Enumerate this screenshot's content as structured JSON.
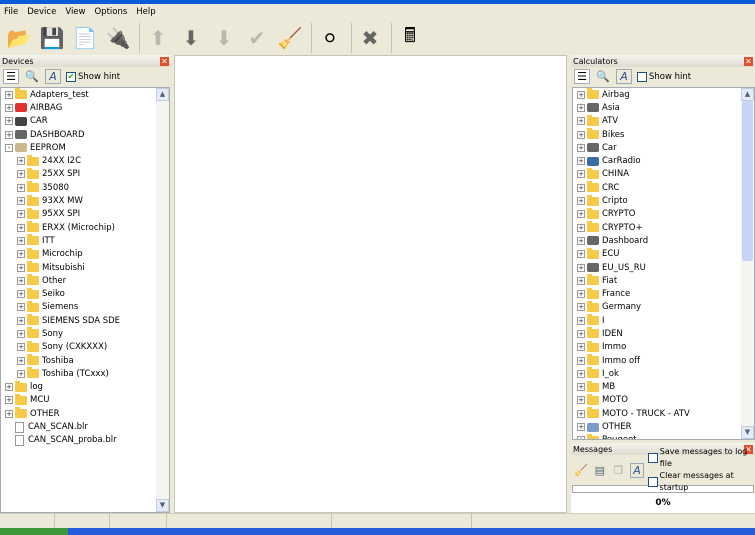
{
  "menu": [
    "File",
    "Device",
    "View",
    "Options",
    "Help"
  ],
  "toolbar": [
    {
      "icon": "open-folder-icon",
      "glyph": "📂"
    },
    {
      "icon": "save-download-icon",
      "glyph": "💾"
    },
    {
      "icon": "new-document-icon",
      "glyph": "📄"
    },
    {
      "icon": "chip-icon",
      "glyph": "🔌"
    },
    {
      "icon": "arrow-up-icon",
      "glyph": "⬆"
    },
    {
      "icon": "arrow-down-icon",
      "glyph": "⬇"
    },
    {
      "icon": "arrow-down-disabled-icon",
      "glyph": "⬇"
    },
    {
      "icon": "check-icon",
      "glyph": "✔"
    },
    {
      "icon": "broom-icon",
      "glyph": "🧹"
    },
    {
      "icon": "disc-icon",
      "glyph": "⚪"
    },
    {
      "icon": "cancel-x-icon",
      "glyph": "✖"
    },
    {
      "icon": "calculator-icon",
      "glyph": "🖩"
    }
  ],
  "devices": {
    "title": "Devices",
    "show_hint": "Show hint",
    "show_hint_checked": true,
    "items": [
      {
        "label": "Adapters_test",
        "level": 0,
        "type": "folder",
        "pm": "+"
      },
      {
        "label": "AIRBAG",
        "level": 0,
        "type": "airbag",
        "pm": "+"
      },
      {
        "label": "CAR",
        "level": 0,
        "type": "car",
        "pm": "+"
      },
      {
        "label": "DASHBOARD",
        "level": 0,
        "type": "dash",
        "pm": "+"
      },
      {
        "label": "EEPROM",
        "level": 0,
        "type": "chip",
        "pm": "-"
      },
      {
        "label": "24XX I2C",
        "level": 1,
        "type": "folder",
        "pm": "+"
      },
      {
        "label": "25XX SPI",
        "level": 1,
        "type": "folder",
        "pm": "+"
      },
      {
        "label": "35080",
        "level": 1,
        "type": "folder",
        "pm": "+"
      },
      {
        "label": "93XX MW",
        "level": 1,
        "type": "folder",
        "pm": "+"
      },
      {
        "label": "95XX SPI",
        "level": 1,
        "type": "folder",
        "pm": "+"
      },
      {
        "label": "ERXX (Microchip)",
        "level": 1,
        "type": "folder",
        "pm": "+"
      },
      {
        "label": "ITT",
        "level": 1,
        "type": "folder",
        "pm": "+"
      },
      {
        "label": "Microchip",
        "level": 1,
        "type": "folder",
        "pm": "+"
      },
      {
        "label": "Mitsubishi",
        "level": 1,
        "type": "folder",
        "pm": "+"
      },
      {
        "label": "Other",
        "level": 1,
        "type": "folder",
        "pm": "+"
      },
      {
        "label": "Seiko",
        "level": 1,
        "type": "folder",
        "pm": "+"
      },
      {
        "label": "Siemens",
        "level": 1,
        "type": "folder",
        "pm": "+"
      },
      {
        "label": "SIEMENS SDA SDE",
        "level": 1,
        "type": "folder",
        "pm": "+"
      },
      {
        "label": "Sony",
        "level": 1,
        "type": "folder",
        "pm": "+"
      },
      {
        "label": "Sony (CXKXXX)",
        "level": 1,
        "type": "folder",
        "pm": "+"
      },
      {
        "label": "Toshiba",
        "level": 1,
        "type": "folder",
        "pm": "+"
      },
      {
        "label": "Toshiba (TCxxx)",
        "level": 1,
        "type": "folder",
        "pm": "+"
      },
      {
        "label": "log",
        "level": 0,
        "type": "folder",
        "pm": "+"
      },
      {
        "label": "MCU",
        "level": 0,
        "type": "folder",
        "pm": "+"
      },
      {
        "label": "OTHER",
        "level": 0,
        "type": "folder",
        "pm": "+"
      },
      {
        "label": "CAN_SCAN.blr",
        "level": 0,
        "type": "file",
        "pm": ""
      },
      {
        "label": "CAN_SCAN_proba.blr",
        "level": 0,
        "type": "file",
        "pm": ""
      }
    ]
  },
  "calculators": {
    "title": "Calculators",
    "show_hint": "Show hint",
    "show_hint_checked": false,
    "items": [
      {
        "label": "Airbag",
        "type": "folder"
      },
      {
        "label": "Asia",
        "type": "dash"
      },
      {
        "label": "ATV",
        "type": "folder"
      },
      {
        "label": "Bikes",
        "type": "folder"
      },
      {
        "label": "Car",
        "type": "dash"
      },
      {
        "label": "CarRadio",
        "type": "radio"
      },
      {
        "label": "CHINA",
        "type": "folder"
      },
      {
        "label": "CRC",
        "type": "folder"
      },
      {
        "label": "Cripto",
        "type": "folder"
      },
      {
        "label": "CRYPTO",
        "type": "folder"
      },
      {
        "label": "CRYPTO+",
        "type": "folder"
      },
      {
        "label": "Dashboard",
        "type": "dash"
      },
      {
        "label": "ECU",
        "type": "folder"
      },
      {
        "label": "EU_US_RU",
        "type": "dash"
      },
      {
        "label": "Fiat",
        "type": "folder"
      },
      {
        "label": "France",
        "type": "folder"
      },
      {
        "label": "Germany",
        "type": "folder"
      },
      {
        "label": "I",
        "type": "folder"
      },
      {
        "label": "IDEN",
        "type": "folder"
      },
      {
        "label": "Immo",
        "type": "folder"
      },
      {
        "label": "Immo off",
        "type": "folder"
      },
      {
        "label": "I_ok",
        "type": "folder"
      },
      {
        "label": "MB",
        "type": "folder"
      },
      {
        "label": "MOTO",
        "type": "folder"
      },
      {
        "label": "MOTO - TRUCK - ATV",
        "type": "folder"
      },
      {
        "label": "OTHER",
        "type": "calc"
      },
      {
        "label": "Peugeot",
        "type": "folder"
      }
    ]
  },
  "messages": {
    "title": "Messages",
    "save_log": "Save messages to log file",
    "clear_startup": "Clear messages at startup",
    "progress": 0,
    "progress_label": "0%"
  },
  "colors": {
    "folder": "#f7c948",
    "accent": "#0a5bd6"
  }
}
